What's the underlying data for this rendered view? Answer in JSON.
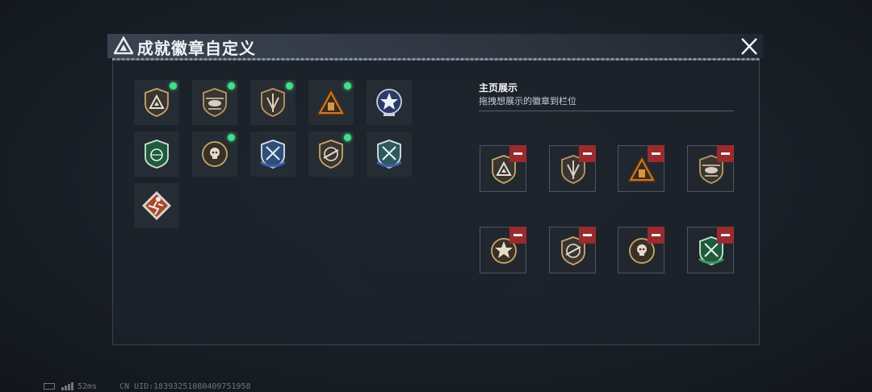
{
  "header": {
    "title": "成就徽章自定义",
    "logo_icon": "triangle-emblem-icon",
    "close_icon": "close-x-icon"
  },
  "owned_badges": [
    {
      "icon": "triangle-shield-badge",
      "is_new": true
    },
    {
      "icon": "helicopter-shield-badge",
      "is_new": true
    },
    {
      "icon": "wings-shield-badge",
      "is_new": true
    },
    {
      "icon": "orange-triangle-badge",
      "is_new": true
    },
    {
      "icon": "star-compass-badge",
      "is_new": false
    },
    {
      "icon": "green-globe-badge",
      "is_new": false
    },
    {
      "icon": "skull-wreath-badge",
      "is_new": true
    },
    {
      "icon": "blue-arrows-wreath-badge",
      "is_new": false
    },
    {
      "icon": "rifle-shield-badge",
      "is_new": true
    },
    {
      "icon": "blue-crossed-arrows-badge",
      "is_new": false
    },
    {
      "icon": "runner-diamond-badge",
      "is_new": false
    }
  ],
  "showcase": {
    "title": "主页展示",
    "subtitle": "拖拽想展示的徽章到栏位",
    "slots": [
      {
        "icon": "triangle-shield-badge",
        "remove_icon": "minus-icon"
      },
      {
        "icon": "wings-shield-badge",
        "remove_icon": "minus-icon"
      },
      {
        "icon": "orange-triangle-badge",
        "remove_icon": "minus-icon"
      },
      {
        "icon": "helicopter-shield-badge",
        "remove_icon": "minus-icon"
      },
      {
        "icon": "star-wreath-badge",
        "remove_icon": "minus-icon"
      },
      {
        "icon": "rifle-shield-badge",
        "remove_icon": "minus-icon"
      },
      {
        "icon": "skull-wreath-badge",
        "remove_icon": "minus-icon"
      },
      {
        "icon": "green-helicopter-wreath-badge",
        "remove_icon": "minus-icon"
      }
    ]
  },
  "status_bar": {
    "battery_icon": "battery-icon",
    "signal_icon": "signal-bars-icon",
    "ping": "52ms",
    "uid": "CN UID:18393251080409751958"
  },
  "colors": {
    "new_dot": "#3fe08a",
    "remove_button": "#9b2a2f",
    "panel_bg": "#1c222a"
  }
}
